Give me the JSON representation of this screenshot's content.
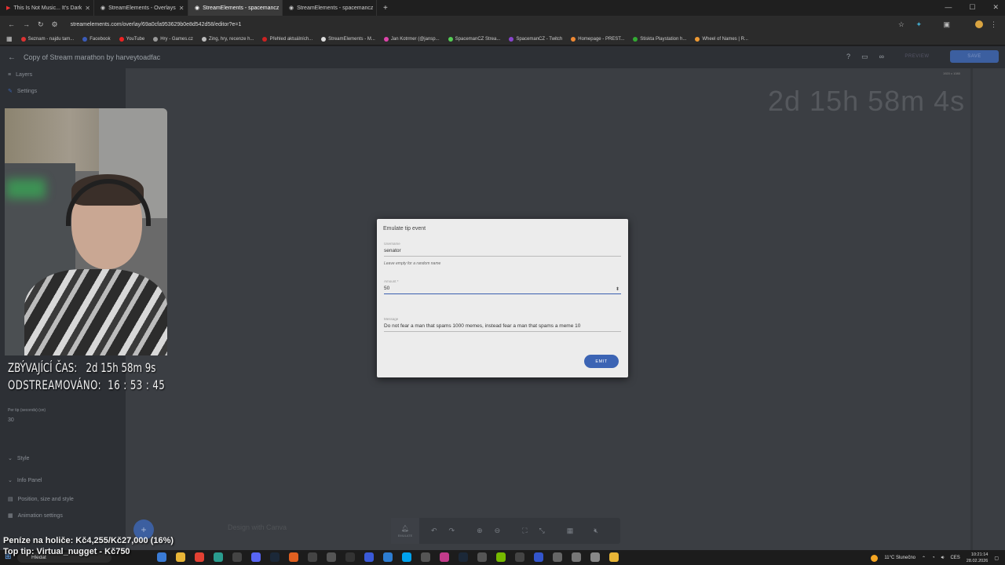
{
  "browser": {
    "tabs": [
      {
        "label": "This Is Not Music... It's Dark",
        "active": false
      },
      {
        "label": "StreamElements - Overlays",
        "active": false
      },
      {
        "label": "StreamElements - spacemancz",
        "active": true
      },
      {
        "label": "StreamElements - spacemancz",
        "active": false
      }
    ],
    "url": "streamelements.com/overlay/69a0cfa953629b0e8d542d58/editor?e=1",
    "bookmarks": [
      "Seznam - najdu tam...",
      "Facebook",
      "YouTube",
      "Hry - Games.cz",
      "Zing, hry, recenze h...",
      "Přehled aktuálních...",
      "StreamElements - M...",
      "Jan Kotrmer (@jansp...",
      "SpacemanCZ Strea...",
      "SpacemanCZ - Twitch",
      "Homepage - PREST...",
      "Stiskta Playstation h...",
      "Wheel of Names | R..."
    ]
  },
  "appbar": {
    "title": "Copy of Stream marathon by harveytoadfac",
    "preview_label": "PREVIEW",
    "save_label": "SAVE"
  },
  "sidebar": {
    "layers_label": "Layers",
    "settings_label": "Settings",
    "per_tip_label": "Per tip (seconds) (on)",
    "per_tip_value": "30",
    "style_label": "Style",
    "info_panel_label": "Info Panel",
    "position_label": "Position, size and style",
    "animation_label": "Animation settings"
  },
  "canvas": {
    "timer_text": "2d 15h 58m 4s",
    "size_text": "1920 x 1080",
    "faded_text": "Design with Canva"
  },
  "overlay": {
    "remaining_label": "ZBÝVAJÍCÍ ČAS:",
    "remaining_value": "2d 15h 58m 9s",
    "streamed_label": "ODSTREAMOVÁNO:",
    "streamed_value": "16 : 53 : 45",
    "money_text": "Peníze na holiče: Kč4,255/Kč27,000 (16%)",
    "top_text": "Top tip: Virtual_nugget - Kč750"
  },
  "dialog": {
    "title": "Emulate tip event",
    "username_label": "Username",
    "username_value": "senator",
    "username_hint": "Leave empty for a random name",
    "amount_label": "Amount *",
    "amount_value": "50",
    "message_label": "Message",
    "message_value": "Do not fear a man that spams 1000 memes, instead fear a man that spams a meme 10",
    "submit_label": "EMIT"
  },
  "toolbar": {
    "emulate_label": "EMULATE"
  },
  "taskbar": {
    "search_placeholder": "Hledat",
    "weather": "11°C Slunečno",
    "lang": "CES",
    "time": "10:21:14",
    "date": "28.02.2026"
  }
}
